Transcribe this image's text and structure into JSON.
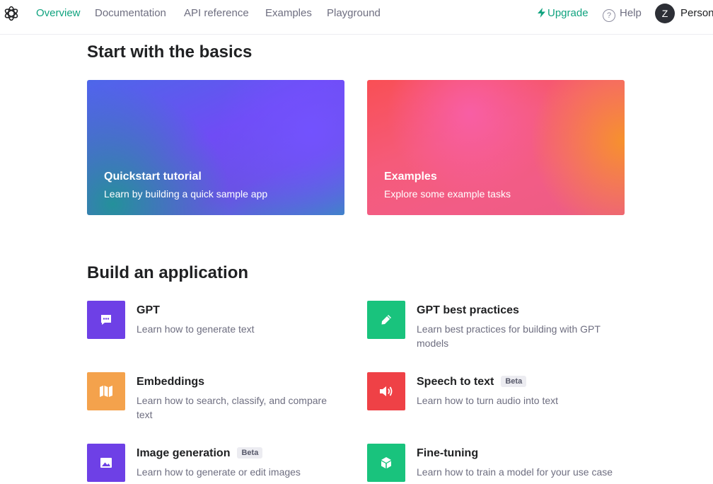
{
  "nav": {
    "links": [
      "Overview",
      "Documentation",
      "API reference",
      "Examples",
      "Playground"
    ],
    "upgrade": "Upgrade",
    "help": "Help",
    "help_glyph": "?",
    "avatar_initial": "Z",
    "user": "Person"
  },
  "basics": {
    "heading": "Start with the basics",
    "cards": [
      {
        "title": "Quickstart tutorial",
        "desc": "Learn by building a quick sample app"
      },
      {
        "title": "Examples",
        "desc": "Explore some example tasks"
      }
    ]
  },
  "build": {
    "heading": "Build an application",
    "apps": [
      {
        "title": "GPT",
        "desc": "Learn how to generate text",
        "badge": "",
        "color": "#6e40e6",
        "icon": "chat-icon"
      },
      {
        "title": "GPT best practices",
        "desc": "Learn best practices for building with GPT models",
        "badge": "",
        "color": "#19c37d",
        "icon": "pencil-icon"
      },
      {
        "title": "Embeddings",
        "desc": "Learn how to search, classify, and compare text",
        "badge": "",
        "color": "#f4a24c",
        "icon": "embeddings-icon"
      },
      {
        "title": "Speech to text",
        "desc": "Learn how to turn audio into text",
        "badge": "Beta",
        "color": "#ef4146",
        "icon": "speaker-icon"
      },
      {
        "title": "Image generation",
        "desc": "Learn how to generate or edit images",
        "badge": "Beta",
        "color": "#6e40e6",
        "icon": "image-icon"
      },
      {
        "title": "Fine-tuning",
        "desc": "Learn how to train a model for your use case",
        "badge": "",
        "color": "#19c37d",
        "icon": "cube-icon"
      }
    ]
  },
  "colors": {
    "accent": "#10a37f",
    "text": "#202123",
    "muted": "#6e6e80"
  }
}
